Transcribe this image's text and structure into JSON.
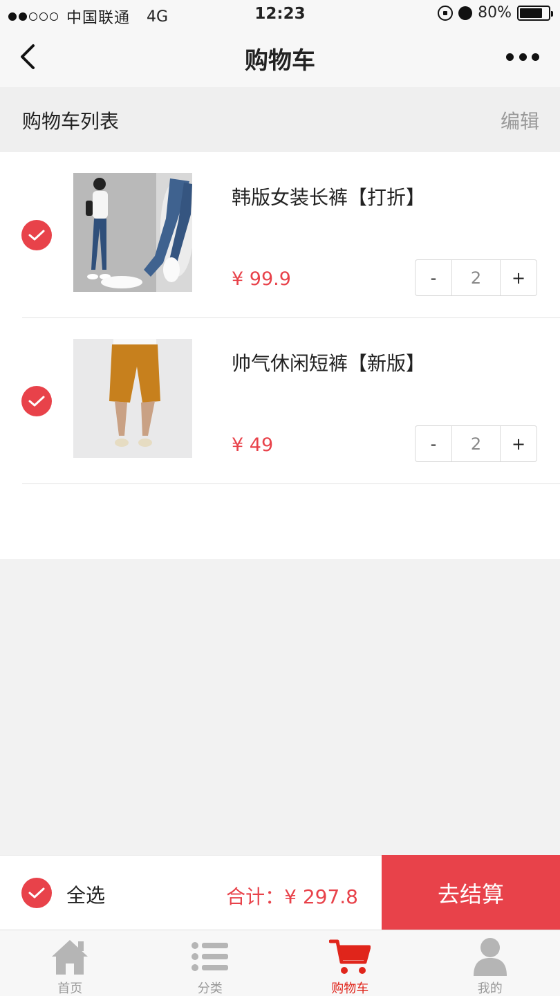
{
  "status_bar": {
    "carrier": "中国联通",
    "network": "4G",
    "time": "12:23",
    "battery": "80%",
    "battery_level": 0.8
  },
  "nav": {
    "title": "购物车"
  },
  "section": {
    "title": "购物车列表",
    "edit_label": "编辑"
  },
  "items": [
    {
      "name": "韩版女装长裤【打折】",
      "price": "¥ 99.9",
      "quantity": "2",
      "minus": "-",
      "plus": "+",
      "checked": true
    },
    {
      "name": "帅气休闲短裤【新版】",
      "price": "¥ 49",
      "quantity": "2",
      "minus": "-",
      "plus": "+",
      "checked": true
    }
  ],
  "checkout": {
    "select_all_label": "全选",
    "total": "合计：¥ 297.8",
    "button_label": "去结算"
  },
  "tabs": [
    {
      "label": "首页",
      "icon": "home-icon"
    },
    {
      "label": "分类",
      "icon": "list-icon"
    },
    {
      "label": "购物车",
      "icon": "cart-icon",
      "active": true
    },
    {
      "label": "我的",
      "icon": "user-icon"
    }
  ],
  "colors": {
    "accent": "#e8424a",
    "tab_active": "#e0251b",
    "tab_inactive": "#b5b5b5"
  }
}
